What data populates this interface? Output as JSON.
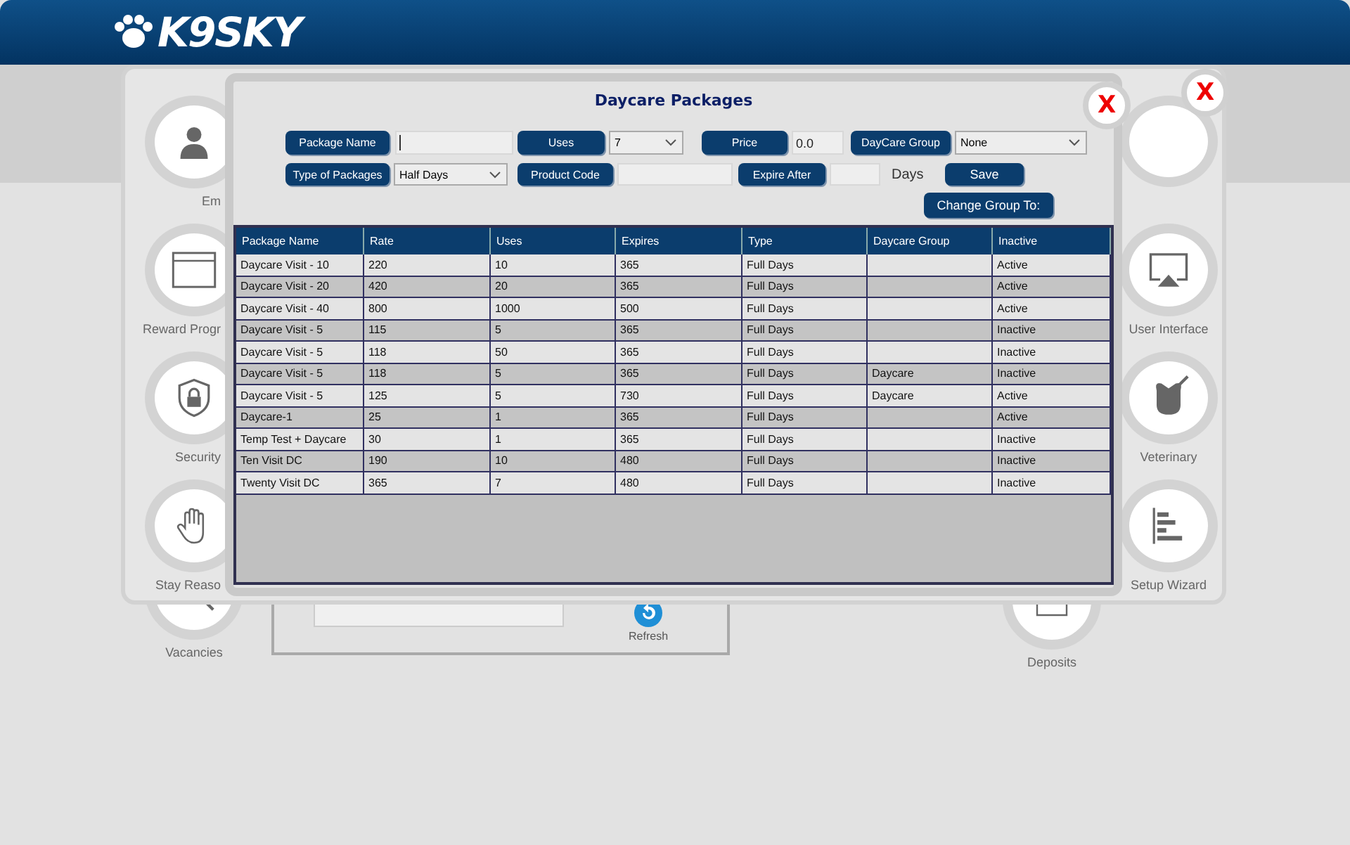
{
  "header": {
    "logo": "K9SKY"
  },
  "background": {
    "tiles": [
      {
        "label": "Vacancies"
      },
      {
        "label": "Deposits"
      }
    ],
    "refresh_label": "Refresh"
  },
  "settings_dialog": {
    "close": "X",
    "left_tiles": [
      {
        "label": "Em"
      },
      {
        "label": "Reward Progr"
      },
      {
        "label": "Security"
      },
      {
        "label": "Stay Reaso"
      }
    ],
    "right_tiles": [
      {
        "label": "User Interface"
      },
      {
        "label": "Veterinary"
      },
      {
        "label": "Setup Wizard"
      }
    ]
  },
  "daycare_dialog": {
    "title": "Daycare Packages",
    "close": "X",
    "form_rows": [
      [
        {
          "kind": "label",
          "text": "Package Name"
        },
        {
          "kind": "input"
        },
        {
          "kind": "label",
          "text": "Uses"
        },
        {
          "kind": "select",
          "value": "7"
        },
        {
          "kind": "label",
          "text": "Price"
        },
        {
          "kind": "input",
          "value": "0.0"
        },
        {
          "kind": "label",
          "text": "DayCare Group"
        },
        {
          "kind": "select",
          "value": "None"
        }
      ],
      [
        {
          "kind": "label",
          "text": "Type of Packages"
        },
        {
          "kind": "select",
          "value": "Half Days"
        },
        {
          "kind": "label",
          "text": "Product Code"
        },
        {
          "kind": "input"
        },
        {
          "kind": "label",
          "text": "Expire After"
        },
        {
          "kind": "input"
        },
        {
          "kind": "text",
          "text": "Days"
        },
        {
          "kind": "button",
          "text": "Save"
        }
      ],
      [
        {
          "kind": "button",
          "text": "Change Group To:"
        }
      ]
    ],
    "table": {
      "columns": [
        "Package Name",
        "Rate",
        "Uses",
        "Expires",
        "Type",
        "Daycare Group",
        "Inactive"
      ],
      "rows": [
        {
          "package_name": "Daycare Visit - 10",
          "rate": "220",
          "uses": "10",
          "expires": "365",
          "type": "Full Days",
          "inactive": "Active"
        },
        {
          "package_name": "Daycare Visit - 20",
          "rate": "420",
          "uses": "20",
          "expires": "365",
          "type": "Full Days",
          "inactive": "Active"
        },
        {
          "package_name": "Daycare Visit - 40",
          "rate": "800",
          "uses": "1000",
          "expires": "500",
          "type": "Full Days",
          "inactive": "Active"
        },
        {
          "package_name": "Daycare Visit - 5",
          "rate": "115",
          "uses": "5",
          "expires": "365",
          "type": "Full Days",
          "inactive": "Inactive"
        },
        {
          "package_name": "Daycare Visit - 5",
          "rate": "118",
          "uses": "50",
          "expires": "365",
          "type": "Full Days",
          "inactive": "Inactive"
        },
        {
          "package_name": "Daycare Visit - 5",
          "rate": "118",
          "uses": "5",
          "expires": "365",
          "type": "Full Days",
          "daycare_group": "Daycare",
          "inactive": "Inactive"
        },
        {
          "package_name": "Daycare Visit - 5",
          "rate": "125",
          "uses": "5",
          "expires": "730",
          "type": "Full Days",
          "daycare_group": "Daycare",
          "inactive": "Active"
        },
        {
          "package_name": "Daycare-1",
          "rate": "25",
          "uses": "1",
          "expires": "365",
          "type": "Full Days",
          "inactive": "Active"
        },
        {
          "package_name": "Temp Test + Daycare",
          "rate": "30",
          "uses": "1",
          "expires": "365",
          "type": "Full Days",
          "inactive": "Inactive"
        },
        {
          "package_name": "Ten Visit DC",
          "rate": "190",
          "uses": "10",
          "expires": "480",
          "type": "Full Days",
          "inactive": "Inactive"
        },
        {
          "package_name": "Twenty Visit DC",
          "rate": "365",
          "uses": "7",
          "expires": "480",
          "type": "Full Days",
          "inactive": "Inactive"
        }
      ]
    }
  }
}
